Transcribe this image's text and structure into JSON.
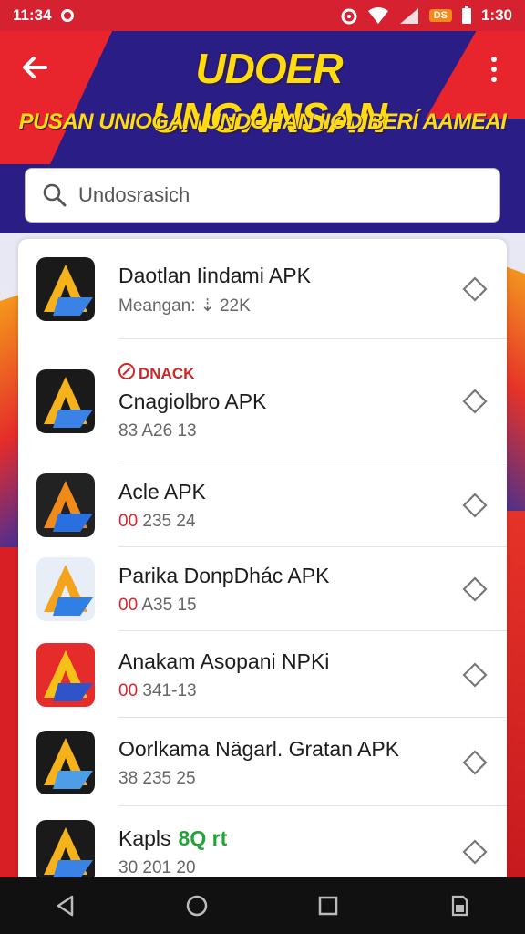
{
  "status_bar": {
    "time": "11:34",
    "battery_label": "DS",
    "clock_right": "1:30"
  },
  "header": {
    "title": "UDOER UNGANSAN",
    "subtitle": "PUSAN UNIOGAN UNDOHAN IIODIBERÍ AAMEAI"
  },
  "search": {
    "placeholder": "Undosrasich"
  },
  "apps": [
    {
      "name": "Daotlan Iindami APK",
      "meta": "Meangan: ⇣ 22K",
      "badge": "",
      "green_tag": "",
      "icon": "arrow-a-icon"
    },
    {
      "name": "Cnagiolbro APK",
      "meta": "83 A26 13",
      "badge": "DNACK",
      "green_tag": "",
      "icon": "arrow-a-icon"
    },
    {
      "name": "Acle APK",
      "meta_prefix": "00",
      "meta": "235 24",
      "badge": "",
      "green_tag": "",
      "icon": "arrow-a-icon"
    },
    {
      "name": "Parika DonpDhác APK",
      "meta_prefix": "00",
      "meta": "A35 15",
      "badge": "",
      "green_tag": "",
      "icon": "arrow-a-icon"
    },
    {
      "name": "Anakam Asopani NPKi",
      "meta_prefix": "00",
      "meta": "341-13",
      "badge": "",
      "green_tag": "",
      "icon": "arrow-a-icon"
    },
    {
      "name": "Oorlkama Nägarl. Gratan APK",
      "meta": "38 235 25",
      "badge": "",
      "green_tag": "",
      "icon": "arrow-a-icon"
    },
    {
      "name": "Kapls",
      "meta": "30 201 20",
      "badge": "",
      "green_tag": "8Q rt",
      "icon": "arrow-a-icon"
    }
  ],
  "colors": {
    "header_bg": "#2a1e86",
    "accent_red": "#e8242c",
    "title_yellow": "#ffdb0f"
  }
}
